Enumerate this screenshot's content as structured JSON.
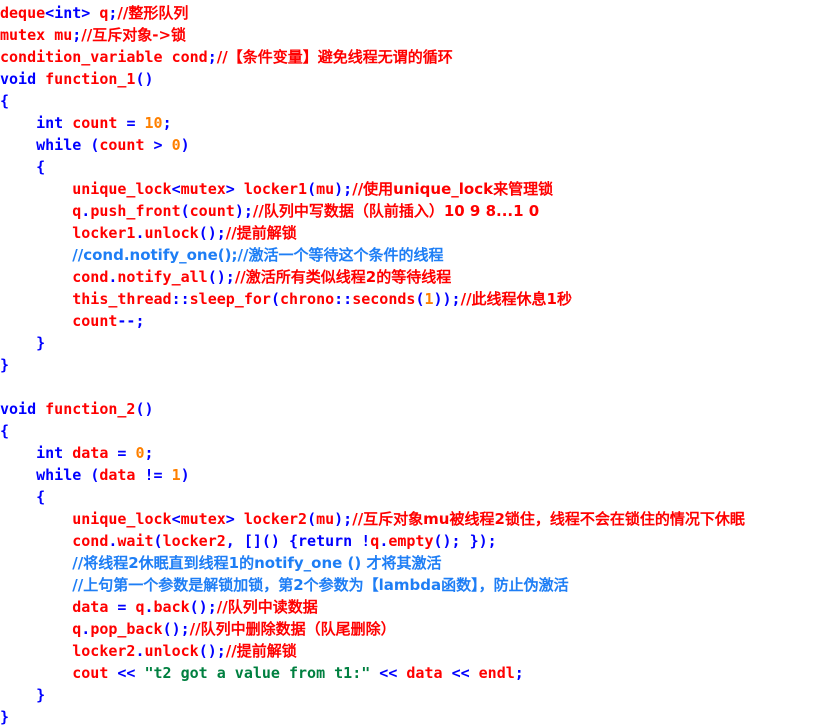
{
  "editor": {
    "language": "C++",
    "background": "#ffffff",
    "theme_colors": {
      "keyword": "#0000ff",
      "punctuation": "#0000ff",
      "identifier": "#ff0000",
      "number": "#ff8000",
      "comment": "#ff0000",
      "comment_blue": "#1e7ef5",
      "string": "#008040"
    }
  },
  "code": {
    "lines": [
      {
        "id": "line-1",
        "tokens": [
          {
            "t": "deque",
            "c": "ident"
          },
          {
            "t": "<",
            "c": "punct"
          },
          {
            "t": "int",
            "c": "key"
          },
          {
            "t": "> ",
            "c": "punct"
          },
          {
            "t": "q",
            "c": "ident"
          },
          {
            "t": ";",
            "c": "punct"
          },
          {
            "t": "//整形队列",
            "c": "cmt"
          }
        ]
      },
      {
        "id": "line-2",
        "tokens": [
          {
            "t": "mutex ",
            "c": "ident"
          },
          {
            "t": "mu",
            "c": "ident"
          },
          {
            "t": ";",
            "c": "punct"
          },
          {
            "t": "//互斥对象->锁",
            "c": "cmt"
          }
        ]
      },
      {
        "id": "line-3",
        "tokens": [
          {
            "t": "condition_variable ",
            "c": "ident"
          },
          {
            "t": "cond",
            "c": "ident"
          },
          {
            "t": ";",
            "c": "punct"
          },
          {
            "t": "//【条件变量】避免线程无谓的循环",
            "c": "cmt"
          }
        ]
      },
      {
        "id": "line-4",
        "tokens": [
          {
            "t": "void ",
            "c": "key"
          },
          {
            "t": "function_1",
            "c": "ident"
          },
          {
            "t": "()",
            "c": "punct"
          }
        ]
      },
      {
        "id": "line-5",
        "tokens": [
          {
            "t": "{",
            "c": "punct"
          }
        ]
      },
      {
        "id": "line-6",
        "tokens": [
          {
            "t": "    ",
            "c": "punct"
          },
          {
            "t": "int ",
            "c": "key"
          },
          {
            "t": "count ",
            "c": "ident"
          },
          {
            "t": "= ",
            "c": "punct"
          },
          {
            "t": "10",
            "c": "num"
          },
          {
            "t": ";",
            "c": "punct"
          }
        ]
      },
      {
        "id": "line-7",
        "tokens": [
          {
            "t": "    ",
            "c": "punct"
          },
          {
            "t": "while ",
            "c": "key"
          },
          {
            "t": "(",
            "c": "punct"
          },
          {
            "t": "count ",
            "c": "ident"
          },
          {
            "t": "> ",
            "c": "punct"
          },
          {
            "t": "0",
            "c": "num"
          },
          {
            "t": ")",
            "c": "punct"
          }
        ]
      },
      {
        "id": "line-8",
        "tokens": [
          {
            "t": "    {",
            "c": "punct"
          }
        ]
      },
      {
        "id": "line-9",
        "tokens": [
          {
            "t": "        ",
            "c": "punct"
          },
          {
            "t": "unique_lock",
            "c": "ident"
          },
          {
            "t": "<",
            "c": "punct"
          },
          {
            "t": "mutex",
            "c": "ident"
          },
          {
            "t": "> ",
            "c": "punct"
          },
          {
            "t": "locker1",
            "c": "ident"
          },
          {
            "t": "(",
            "c": "punct"
          },
          {
            "t": "mu",
            "c": "ident"
          },
          {
            "t": ");",
            "c": "punct"
          },
          {
            "t": "//使用unique_lock来管理锁",
            "c": "cmt"
          }
        ]
      },
      {
        "id": "line-10",
        "tokens": [
          {
            "t": "        ",
            "c": "punct"
          },
          {
            "t": "q",
            "c": "ident"
          },
          {
            "t": ".",
            "c": "punct"
          },
          {
            "t": "push_front",
            "c": "ident"
          },
          {
            "t": "(",
            "c": "punct"
          },
          {
            "t": "count",
            "c": "ident"
          },
          {
            "t": ");",
            "c": "punct"
          },
          {
            "t": "//队列中写数据（队前插入）10 9 8...1 0",
            "c": "cmt"
          }
        ]
      },
      {
        "id": "line-11",
        "tokens": [
          {
            "t": "        ",
            "c": "punct"
          },
          {
            "t": "locker1",
            "c": "ident"
          },
          {
            "t": ".",
            "c": "punct"
          },
          {
            "t": "unlock",
            "c": "ident"
          },
          {
            "t": "();",
            "c": "punct"
          },
          {
            "t": "//提前解锁",
            "c": "cmt"
          }
        ]
      },
      {
        "id": "line-12",
        "tokens": [
          {
            "t": "        ",
            "c": "punct"
          },
          {
            "t": "//cond.notify_one();//激活一个等待这个条件的线程",
            "c": "cmt-blue"
          }
        ]
      },
      {
        "id": "line-13",
        "tokens": [
          {
            "t": "        ",
            "c": "punct"
          },
          {
            "t": "cond",
            "c": "ident"
          },
          {
            "t": ".",
            "c": "punct"
          },
          {
            "t": "notify_all",
            "c": "ident"
          },
          {
            "t": "();",
            "c": "punct"
          },
          {
            "t": "//激活所有类似线程2的等待线程",
            "c": "cmt"
          }
        ]
      },
      {
        "id": "line-14",
        "tokens": [
          {
            "t": "        ",
            "c": "punct"
          },
          {
            "t": "this_thread",
            "c": "ident"
          },
          {
            "t": "::",
            "c": "punct"
          },
          {
            "t": "sleep_for",
            "c": "ident"
          },
          {
            "t": "(",
            "c": "punct"
          },
          {
            "t": "chrono",
            "c": "ident"
          },
          {
            "t": "::",
            "c": "punct"
          },
          {
            "t": "seconds",
            "c": "ident"
          },
          {
            "t": "(",
            "c": "punct"
          },
          {
            "t": "1",
            "c": "num"
          },
          {
            "t": "));",
            "c": "punct"
          },
          {
            "t": "//此线程休息1秒",
            "c": "cmt"
          }
        ]
      },
      {
        "id": "line-15",
        "tokens": [
          {
            "t": "        ",
            "c": "punct"
          },
          {
            "t": "count",
            "c": "ident"
          },
          {
            "t": "--;",
            "c": "punct"
          }
        ]
      },
      {
        "id": "line-16",
        "tokens": [
          {
            "t": "    }",
            "c": "punct"
          }
        ]
      },
      {
        "id": "line-17",
        "tokens": [
          {
            "t": "}",
            "c": "punct"
          }
        ]
      },
      {
        "id": "line-18",
        "tokens": []
      },
      {
        "id": "line-19",
        "tokens": [
          {
            "t": "void ",
            "c": "key"
          },
          {
            "t": "function_2",
            "c": "ident"
          },
          {
            "t": "()",
            "c": "punct"
          }
        ]
      },
      {
        "id": "line-20",
        "tokens": [
          {
            "t": "{",
            "c": "punct"
          }
        ]
      },
      {
        "id": "line-21",
        "tokens": [
          {
            "t": "    ",
            "c": "punct"
          },
          {
            "t": "int ",
            "c": "key"
          },
          {
            "t": "data ",
            "c": "ident"
          },
          {
            "t": "= ",
            "c": "punct"
          },
          {
            "t": "0",
            "c": "num"
          },
          {
            "t": ";",
            "c": "punct"
          }
        ]
      },
      {
        "id": "line-22",
        "tokens": [
          {
            "t": "    ",
            "c": "punct"
          },
          {
            "t": "while ",
            "c": "key"
          },
          {
            "t": "(",
            "c": "punct"
          },
          {
            "t": "data ",
            "c": "ident"
          },
          {
            "t": "!= ",
            "c": "punct"
          },
          {
            "t": "1",
            "c": "num"
          },
          {
            "t": ")",
            "c": "punct"
          }
        ]
      },
      {
        "id": "line-23",
        "tokens": [
          {
            "t": "    {",
            "c": "punct"
          }
        ]
      },
      {
        "id": "line-24",
        "tokens": [
          {
            "t": "        ",
            "c": "punct"
          },
          {
            "t": "unique_lock",
            "c": "ident"
          },
          {
            "t": "<",
            "c": "punct"
          },
          {
            "t": "mutex",
            "c": "ident"
          },
          {
            "t": "> ",
            "c": "punct"
          },
          {
            "t": "locker2",
            "c": "ident"
          },
          {
            "t": "(",
            "c": "punct"
          },
          {
            "t": "mu",
            "c": "ident"
          },
          {
            "t": ");",
            "c": "punct"
          },
          {
            "t": "//互斥对象mu被线程2锁住，线程不会在锁住的情况下休眠",
            "c": "cmt"
          }
        ]
      },
      {
        "id": "line-25",
        "tokens": [
          {
            "t": "        ",
            "c": "punct"
          },
          {
            "t": "cond",
            "c": "ident"
          },
          {
            "t": ".",
            "c": "punct"
          },
          {
            "t": "wait",
            "c": "ident"
          },
          {
            "t": "(",
            "c": "punct"
          },
          {
            "t": "locker2",
            "c": "ident"
          },
          {
            "t": ", []() {",
            "c": "punct"
          },
          {
            "t": "return ",
            "c": "key"
          },
          {
            "t": "!",
            "c": "punct"
          },
          {
            "t": "q",
            "c": "ident"
          },
          {
            "t": ".",
            "c": "punct"
          },
          {
            "t": "empty",
            "c": "ident"
          },
          {
            "t": "(); });",
            "c": "punct"
          }
        ]
      },
      {
        "id": "line-26",
        "tokens": [
          {
            "t": "        ",
            "c": "punct"
          },
          {
            "t": "//将线程2休眠直到线程1的notify_one () 才将其激活",
            "c": "cmt-blue"
          }
        ]
      },
      {
        "id": "line-27",
        "tokens": [
          {
            "t": "        ",
            "c": "punct"
          },
          {
            "t": "//上句第一个参数是解锁加锁，第2个参数为【lambda函数】，防止伪激活",
            "c": "cmt-blue"
          }
        ]
      },
      {
        "id": "line-28",
        "tokens": [
          {
            "t": "        ",
            "c": "punct"
          },
          {
            "t": "data ",
            "c": "ident"
          },
          {
            "t": "= ",
            "c": "punct"
          },
          {
            "t": "q",
            "c": "ident"
          },
          {
            "t": ".",
            "c": "punct"
          },
          {
            "t": "back",
            "c": "ident"
          },
          {
            "t": "();",
            "c": "punct"
          },
          {
            "t": "//队列中读数据",
            "c": "cmt"
          }
        ]
      },
      {
        "id": "line-29",
        "tokens": [
          {
            "t": "        ",
            "c": "punct"
          },
          {
            "t": "q",
            "c": "ident"
          },
          {
            "t": ".",
            "c": "punct"
          },
          {
            "t": "pop_back",
            "c": "ident"
          },
          {
            "t": "();",
            "c": "punct"
          },
          {
            "t": "//队列中删除数据（队尾删除）",
            "c": "cmt"
          }
        ]
      },
      {
        "id": "line-30",
        "tokens": [
          {
            "t": "        ",
            "c": "punct"
          },
          {
            "t": "locker2",
            "c": "ident"
          },
          {
            "t": ".",
            "c": "punct"
          },
          {
            "t": "unlock",
            "c": "ident"
          },
          {
            "t": "();",
            "c": "punct"
          },
          {
            "t": "//提前解锁",
            "c": "cmt"
          }
        ]
      },
      {
        "id": "line-31",
        "tokens": [
          {
            "t": "        ",
            "c": "punct"
          },
          {
            "t": "cout ",
            "c": "ident"
          },
          {
            "t": "<< ",
            "c": "punct"
          },
          {
            "t": "\"t2 got a value from t1:\"",
            "c": "str"
          },
          {
            "t": " << ",
            "c": "punct"
          },
          {
            "t": "data ",
            "c": "ident"
          },
          {
            "t": "<< ",
            "c": "punct"
          },
          {
            "t": "endl",
            "c": "ident"
          },
          {
            "t": ";",
            "c": "punct"
          }
        ]
      },
      {
        "id": "line-32",
        "tokens": [
          {
            "t": "    }",
            "c": "punct"
          }
        ]
      },
      {
        "id": "line-33",
        "tokens": [
          {
            "t": "}",
            "c": "punct"
          }
        ]
      }
    ]
  }
}
